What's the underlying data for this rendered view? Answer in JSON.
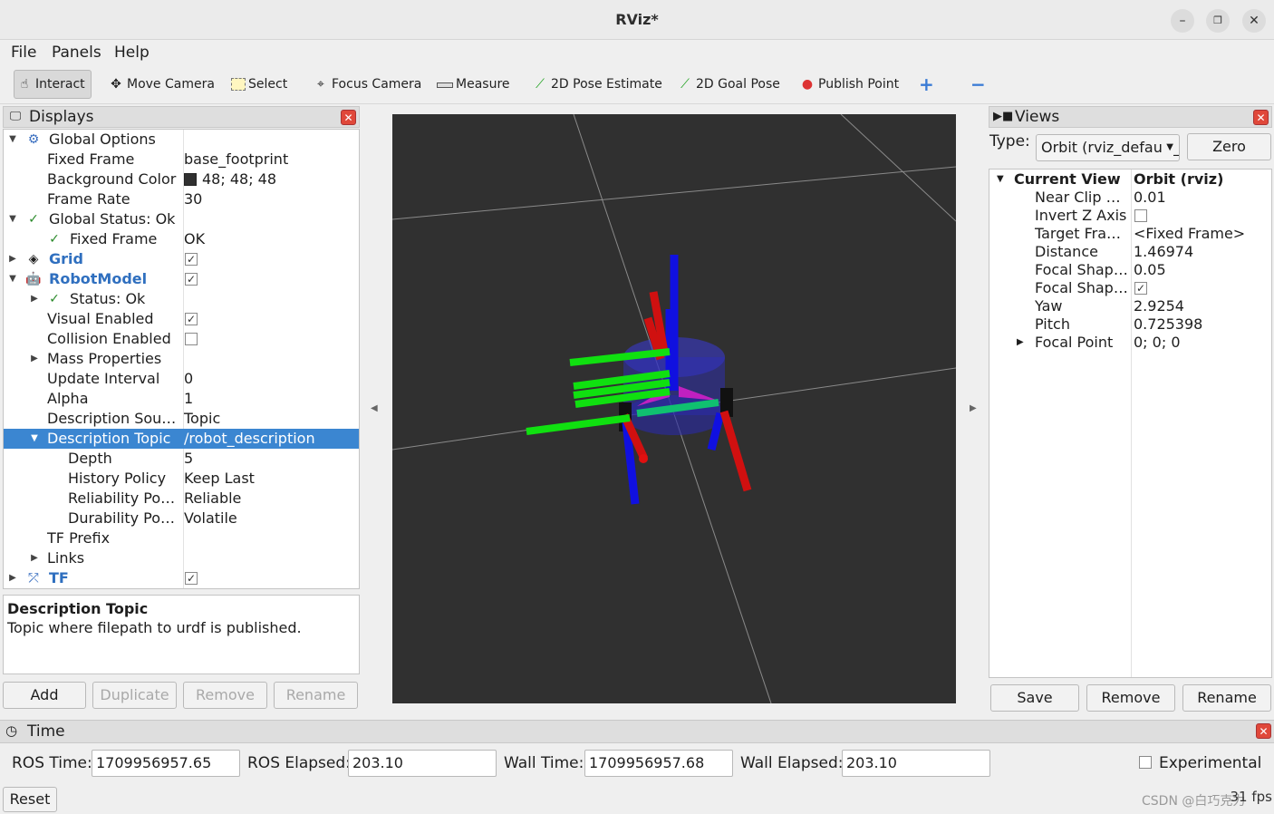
{
  "window": {
    "title": "RViz*"
  },
  "menu": [
    "File",
    "Panels",
    "Help"
  ],
  "toolbar": {
    "interact": "Interact",
    "move_camera": "Move Camera",
    "select": "Select",
    "focus_camera": "Focus Camera",
    "measure": "Measure",
    "pose_estimate": "2D Pose Estimate",
    "goal_pose": "2D Goal Pose",
    "publish_point": "Publish Point"
  },
  "displays": {
    "title": "Displays",
    "rows": [
      {
        "label": "Global Options",
        "value": ""
      },
      {
        "label": "Fixed Frame",
        "value": "base_footprint"
      },
      {
        "label": "Background Color",
        "value": "48; 48; 48"
      },
      {
        "label": "Frame Rate",
        "value": "30"
      },
      {
        "label": "Global Status: Ok",
        "value": ""
      },
      {
        "label": "Fixed Frame",
        "value": "OK"
      },
      {
        "label": "Grid",
        "value": ""
      },
      {
        "label": "RobotModel",
        "value": ""
      },
      {
        "label": "Status: Ok",
        "value": ""
      },
      {
        "label": "Visual Enabled",
        "value": ""
      },
      {
        "label": "Collision Enabled",
        "value": ""
      },
      {
        "label": "Mass Properties",
        "value": ""
      },
      {
        "label": "Update Interval",
        "value": "0"
      },
      {
        "label": "Alpha",
        "value": "1"
      },
      {
        "label": "Description Sou…",
        "value": "Topic"
      },
      {
        "label": "Description Topic",
        "value": "/robot_description"
      },
      {
        "label": "Depth",
        "value": "5"
      },
      {
        "label": "History Policy",
        "value": "Keep Last"
      },
      {
        "label": "Reliability Po…",
        "value": "Reliable"
      },
      {
        "label": "Durability Po…",
        "value": "Volatile"
      },
      {
        "label": "TF Prefix",
        "value": ""
      },
      {
        "label": "Links",
        "value": ""
      },
      {
        "label": "TF",
        "value": ""
      }
    ],
    "description_title": "Description Topic",
    "description_text": "Topic where filepath to urdf is published.",
    "buttons": {
      "add": "Add",
      "duplicate": "Duplicate",
      "remove": "Remove",
      "rename": "Rename"
    }
  },
  "views": {
    "title": "Views",
    "type_label": "Type:",
    "type_value": "Orbit (rviz_default_plugins)",
    "zero": "Zero",
    "rows": [
      {
        "label": "Current View",
        "value": "Orbit (rviz)"
      },
      {
        "label": "Near Clip …",
        "value": "0.01"
      },
      {
        "label": "Invert Z Axis",
        "value": ""
      },
      {
        "label": "Target Fra…",
        "value": "<Fixed Frame>"
      },
      {
        "label": "Distance",
        "value": "1.46974"
      },
      {
        "label": "Focal Shap…",
        "value": "0.05"
      },
      {
        "label": "Focal Shap…",
        "value": ""
      },
      {
        "label": "Yaw",
        "value": "2.9254"
      },
      {
        "label": "Pitch",
        "value": "0.725398"
      },
      {
        "label": "Focal Point",
        "value": "0; 0; 0"
      }
    ],
    "buttons": {
      "save": "Save",
      "remove": "Remove",
      "rename": "Rename"
    }
  },
  "time": {
    "title": "Time",
    "ros_time_label": "ROS Time:",
    "ros_time": "1709956957.65",
    "ros_elapsed_label": "ROS Elapsed:",
    "ros_elapsed": "203.10",
    "wall_time_label": "Wall Time:",
    "wall_time": "1709956957.68",
    "wall_elapsed_label": "Wall Elapsed:",
    "wall_elapsed": "203.10",
    "experimental": "Experimental",
    "reset": "Reset",
    "fps": "31 fps"
  },
  "watermark": "CSDN @白巧克力",
  "colors": {
    "viewport_bg": "#303030",
    "selection": "#3b86d1",
    "x_axis": "#e01010",
    "y_axis": "#10e010",
    "z_axis": "#1010e0"
  }
}
